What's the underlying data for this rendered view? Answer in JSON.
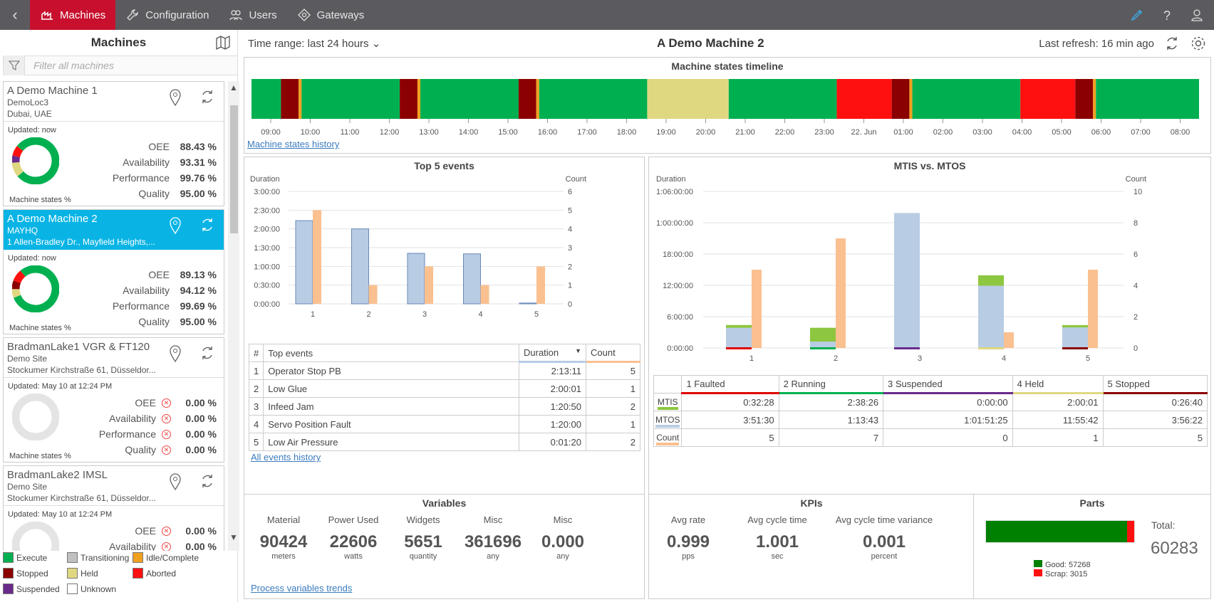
{
  "nav": {
    "back": "‹",
    "tabs": [
      {
        "label": "Machines",
        "icon": "machine-icon",
        "active": true
      },
      {
        "label": "Configuration",
        "icon": "wrench-icon"
      },
      {
        "label": "Users",
        "icon": "users-icon"
      },
      {
        "label": "Gateways",
        "icon": "gateway-icon"
      }
    ]
  },
  "sidebar": {
    "title": "Machines",
    "filter_placeholder": "Filter all machines",
    "machines": [
      {
        "name": "A Demo Machine 1",
        "site": "DemoLoc3",
        "address": "Dubai, UAE",
        "updated": "Updated: now",
        "oee": "88.43 %",
        "availability": "93.31 %",
        "performance": "99.76 %",
        "quality": "95.00 %",
        "selected": false,
        "ok": true
      },
      {
        "name": "A Demo Machine 2",
        "site": "MAYHQ",
        "address": "1 Allen-Bradley Dr., Mayfield Heights,...",
        "updated": "Updated: now",
        "oee": "89.13 %",
        "availability": "94.12 %",
        "performance": "99.69 %",
        "quality": "95.00 %",
        "selected": true,
        "ok": true
      },
      {
        "name": "BradmanLake1 VGR & FT120",
        "site": "Demo Site",
        "address": "Stockumer Kirchstraße 61, Düsseldor...",
        "updated": "Updated: May 10 at 12:24 PM",
        "oee": "0.00 %",
        "availability": "0.00 %",
        "performance": "0.00 %",
        "quality": "0.00 %",
        "selected": false,
        "ok": false
      },
      {
        "name": "BradmanLake2 IMSL",
        "site": "Demo Site",
        "address": "Stockumer Kirchstraße 61, Düsseldor...",
        "updated": "Updated: May 10 at 12:24 PM",
        "oee": "0.00 %",
        "availability": "0.00 %",
        "performance": "",
        "quality": "",
        "selected": false,
        "ok": false
      }
    ],
    "labels": {
      "oee": "OEE",
      "availability": "Availability",
      "performance": "Performance",
      "quality": "Quality",
      "machine_states": "Machine states %"
    },
    "legend": [
      {
        "label": "Execute",
        "color": "#00b050"
      },
      {
        "label": "Transitioning",
        "color": "#c0c0c0"
      },
      {
        "label": "Idle/Complete",
        "color": "#f0a020"
      },
      {
        "label": "Stopped",
        "color": "#8b0000"
      },
      {
        "label": "Held",
        "color": "#e0d880"
      },
      {
        "label": "Aborted",
        "color": "#ff1010"
      },
      {
        "label": "Suspended",
        "color": "#6a2a8a"
      },
      {
        "label": "Unknown",
        "color": "#ffffff"
      }
    ]
  },
  "header": {
    "time_range": "Time range: last 24 hours",
    "title": "A Demo Machine 2",
    "last_refresh": "Last refresh: 16 min ago"
  },
  "timeline": {
    "title": "Machine states timeline",
    "link": "Machine states history",
    "ticks": [
      "09:00",
      "10:00",
      "11:00",
      "12:00",
      "13:00",
      "14:00",
      "15:00",
      "16:00",
      "17:00",
      "18:00",
      "19:00",
      "20:00",
      "21:00",
      "22:00",
      "23:00",
      "22. Jun",
      "01:00",
      "02:00",
      "03:00",
      "04:00",
      "05:00",
      "06:00",
      "07:00",
      "08:00"
    ],
    "segments": [
      {
        "s": "Execute",
        "d": 0.03
      },
      {
        "s": "Stopped",
        "d": 0.018
      },
      {
        "s": "Idle/Complete",
        "d": 0.003
      },
      {
        "s": "Execute",
        "d": 0.1
      },
      {
        "s": "Stopped",
        "d": 0.018
      },
      {
        "s": "Idle/Complete",
        "d": 0.003
      },
      {
        "s": "Execute",
        "d": 0.1
      },
      {
        "s": "Stopped",
        "d": 0.018
      },
      {
        "s": "Idle/Complete",
        "d": 0.003
      },
      {
        "s": "Execute",
        "d": 0.11
      },
      {
        "s": "Held",
        "d": 0.083
      },
      {
        "s": "Execute",
        "d": 0.11
      },
      {
        "s": "Aborted",
        "d": 0.056
      },
      {
        "s": "Stopped",
        "d": 0.018
      },
      {
        "s": "Idle/Complete",
        "d": 0.003
      },
      {
        "s": "Execute",
        "d": 0.11
      },
      {
        "s": "Aborted",
        "d": 0.056
      },
      {
        "s": "Stopped",
        "d": 0.018
      },
      {
        "s": "Idle/Complete",
        "d": 0.003
      },
      {
        "s": "Execute",
        "d": 0.105
      }
    ]
  },
  "top5": {
    "title": "Top 5 events",
    "left_axis": "Duration",
    "right_axis": "Count",
    "left_ticks": [
      "3:00:00",
      "2:30:00",
      "2:00:00",
      "1:30:00",
      "1:00:00",
      "0:30:00",
      "0:00:00"
    ],
    "right_ticks": [
      "6",
      "5",
      "4",
      "3",
      "2",
      "1",
      "0"
    ],
    "table_headers": {
      "num": "#",
      "event": "Top events",
      "duration": "Duration",
      "count": "Count"
    },
    "rows": [
      {
        "n": "1",
        "event": "Operator Stop PB",
        "duration": "2:13:11",
        "count": "5"
      },
      {
        "n": "2",
        "event": "Low Glue",
        "duration": "2:00:01",
        "count": "1"
      },
      {
        "n": "3",
        "event": "Infeed Jam",
        "duration": "1:20:50",
        "count": "2"
      },
      {
        "n": "4",
        "event": "Servo Position Fault",
        "duration": "1:20:00",
        "count": "1"
      },
      {
        "n": "5",
        "event": "Low Air Pressure",
        "duration": "0:01:20",
        "count": "2"
      }
    ],
    "link": "All events history"
  },
  "mtis": {
    "title": "MTIS vs. MTOS",
    "left_axis": "Duration",
    "right_axis": "Count",
    "left_ticks": [
      "1:06:00:00",
      "1:00:00:00",
      "18:00:00",
      "12:00:00",
      "6:00:00",
      "0:00:00"
    ],
    "right_ticks": [
      "10",
      "8",
      "6",
      "4",
      "2",
      "0"
    ],
    "columns": [
      {
        "label": "1 Faulted",
        "color": "#e00000",
        "mtis": "0:32:28",
        "mtos": "3:51:30",
        "count": "5"
      },
      {
        "label": "2 Running",
        "color": "#00b050",
        "mtis": "2:38:26",
        "mtos": "1:13:43",
        "count": "7"
      },
      {
        "label": "3 Suspended",
        "color": "#6a2a8a",
        "mtis": "0:00:00",
        "mtos": "1:01:51:25",
        "count": "0"
      },
      {
        "label": "4 Held",
        "color": "#e0d880",
        "mtis": "2:00:01",
        "mtos": "11:55:42",
        "count": "1"
      },
      {
        "label": "5 Stopped",
        "color": "#8b0000",
        "mtis": "0:26:40",
        "mtos": "3:56:22",
        "count": "5"
      }
    ],
    "row_labels": {
      "mtis": "MTIS",
      "mtos": "MTOS",
      "count": "Count"
    }
  },
  "variables": {
    "title": "Variables",
    "items": [
      {
        "label": "Material",
        "value": "90424",
        "unit": "meters"
      },
      {
        "label": "Power Used",
        "value": "22606",
        "unit": "watts"
      },
      {
        "label": "Widgets",
        "value": "5651",
        "unit": "quantity"
      },
      {
        "label": "Misc",
        "value": "361696",
        "unit": "any"
      },
      {
        "label": "Misc",
        "value": "0.000",
        "unit": "any"
      }
    ],
    "link": "Process variables trends"
  },
  "kpis": {
    "title": "KPIs",
    "items": [
      {
        "label": "Avg rate",
        "value": "0.999",
        "unit": "pps"
      },
      {
        "label": "Avg cycle time",
        "value": "1.001",
        "unit": "sec"
      },
      {
        "label": "Avg cycle time variance",
        "value": "0.001",
        "unit": "percent"
      }
    ]
  },
  "parts": {
    "title": "Parts",
    "total_label": "Total:",
    "total": "60283",
    "good_label": "Good: 57268",
    "scrap_label": "Scrap: 3015",
    "good": 57268,
    "scrap": 3015
  },
  "chart_data": [
    {
      "type": "bar",
      "title": "Top 5 events",
      "categories": [
        "1",
        "2",
        "3",
        "4",
        "5"
      ],
      "series": [
        {
          "name": "Duration",
          "values": [
            "2:13:11",
            "2:00:01",
            "1:20:50",
            "1:20:00",
            "0:01:20"
          ]
        },
        {
          "name": "Count",
          "values": [
            5,
            1,
            2,
            1,
            2
          ]
        }
      ],
      "xlabel": "",
      "ylabel": "Duration",
      "ylim": [
        "0:00:00",
        "3:00:00"
      ],
      "y2label": "Count",
      "y2lim": [
        0,
        6
      ]
    },
    {
      "type": "bar",
      "title": "MTIS vs. MTOS",
      "categories": [
        "1",
        "2",
        "3",
        "4",
        "5"
      ],
      "series": [
        {
          "name": "MTIS",
          "values": [
            "0:32:28",
            "2:38:26",
            "0:00:00",
            "2:00:01",
            "0:26:40"
          ]
        },
        {
          "name": "MTOS",
          "values": [
            "3:51:30",
            "1:13:43",
            "1:01:51:25",
            "11:55:42",
            "3:56:22"
          ]
        },
        {
          "name": "Count",
          "values": [
            5,
            7,
            0,
            1,
            5
          ]
        }
      ],
      "ylabel": "Duration",
      "ylim": [
        "0:00:00",
        "1:06:00:00"
      ],
      "y2label": "Count",
      "y2lim": [
        0,
        10
      ]
    }
  ]
}
